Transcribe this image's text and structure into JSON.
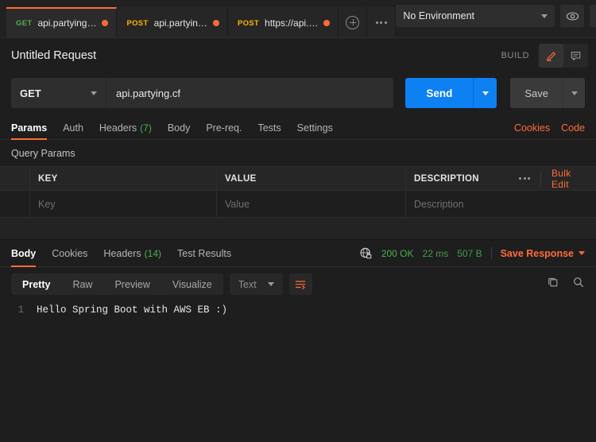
{
  "tabbar": {
    "tabs": [
      {
        "method": "GET",
        "method_class": "get",
        "name": "api.partying…",
        "unsaved": true,
        "active": true
      },
      {
        "method": "POST",
        "method_class": "post",
        "name": "api.partyin…",
        "unsaved": true,
        "active": false
      },
      {
        "method": "POST",
        "method_class": "post",
        "name": "https://api.…",
        "unsaved": true,
        "active": false
      }
    ],
    "new_tab_icon": "plus-circle-icon",
    "more_icon": "more-horizontal-icon",
    "environment": {
      "selected": "No Environment"
    },
    "eye_icon": "eye-icon",
    "settings_icon": "sliders-icon"
  },
  "request_header": {
    "title": "Untitled Request",
    "build_label": "BUILD",
    "edit_icon": "pencil-icon",
    "comment_icon": "comment-icon"
  },
  "url_bar": {
    "method": "GET",
    "url": "api.partying.cf",
    "send_label": "Send",
    "save_label": "Save"
  },
  "request_tabs": {
    "items": [
      {
        "label": "Params",
        "count": "",
        "active": true
      },
      {
        "label": "Auth",
        "count": "",
        "active": false
      },
      {
        "label": "Headers",
        "count": "(7)",
        "active": false
      },
      {
        "label": "Body",
        "count": "",
        "active": false
      },
      {
        "label": "Pre-req.",
        "count": "",
        "active": false
      },
      {
        "label": "Tests",
        "count": "",
        "active": false
      },
      {
        "label": "Settings",
        "count": "",
        "active": false
      }
    ],
    "links": [
      {
        "label": "Cookies"
      },
      {
        "label": "Code"
      }
    ]
  },
  "query_params": {
    "section_title": "Query Params",
    "columns": [
      "KEY",
      "VALUE",
      "DESCRIPTION"
    ],
    "more_icon": "more-horizontal-icon",
    "bulk_edit_label": "Bulk Edit",
    "rows": [
      {
        "key": "Key",
        "value": "Value",
        "description": "Description"
      }
    ]
  },
  "response": {
    "tabs": [
      {
        "label": "Body",
        "count": "",
        "active": true
      },
      {
        "label": "Cookies",
        "count": "",
        "active": false
      },
      {
        "label": "Headers",
        "count": "(14)",
        "active": false
      },
      {
        "label": "Test Results",
        "count": "",
        "active": false
      }
    ],
    "globe_icon": "globe-lock-icon",
    "status": "200 OK",
    "time": "22 ms",
    "size": "507 B",
    "save_response_label": "Save Response",
    "format_tabs": [
      {
        "label": "Pretty",
        "active": true
      },
      {
        "label": "Raw",
        "active": false
      },
      {
        "label": "Preview",
        "active": false
      },
      {
        "label": "Visualize",
        "active": false
      }
    ],
    "language": "Text",
    "wrap_icon": "word-wrap-icon",
    "copy_icon": "copy-icon",
    "search_icon": "search-icon",
    "body_lines": [
      {
        "number": "1",
        "text": "Hello Spring Boot with AWS EB :)"
      }
    ]
  },
  "colors": {
    "accent": "#ff6c37",
    "send": "#0d80f2",
    "success": "#4caf50",
    "post": "#ffb300"
  }
}
